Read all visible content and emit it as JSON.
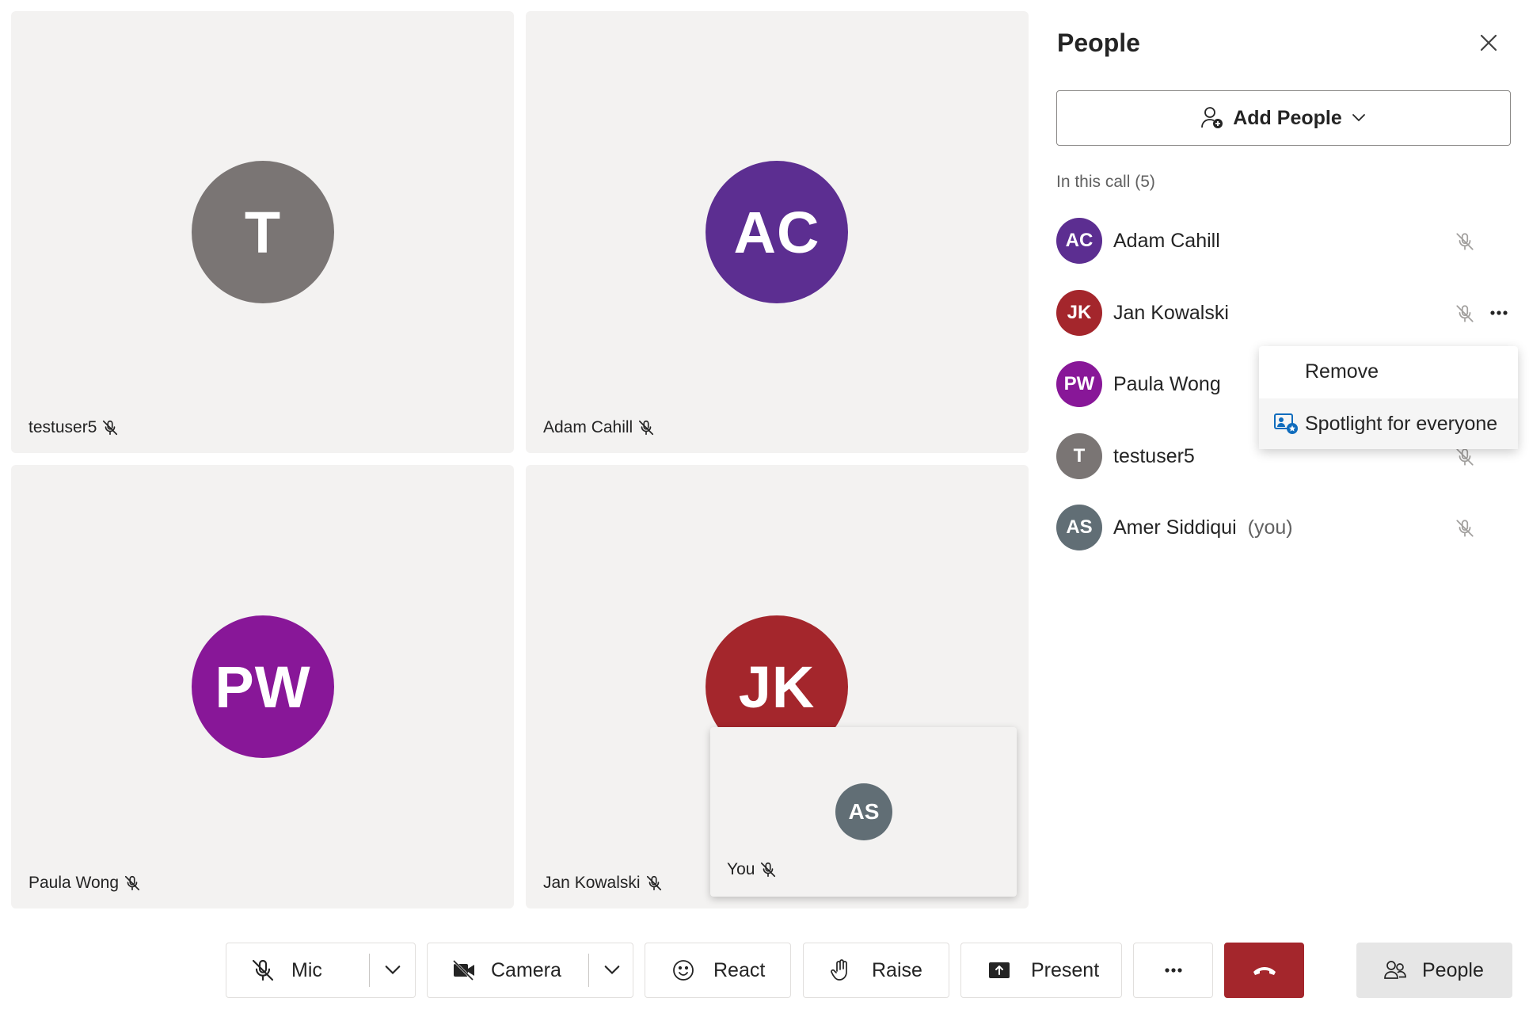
{
  "tiles": [
    {
      "initials": "T",
      "name": "testuser5",
      "color": "#7a7574"
    },
    {
      "initials": "AC",
      "name": "Adam Cahill",
      "color": "#5c2e91"
    },
    {
      "initials": "PW",
      "name": "Paula Wong",
      "color": "#881798"
    },
    {
      "initials": "JK",
      "name": "Jan Kowalski",
      "color": "#a4262c"
    }
  ],
  "self_view": {
    "initials": "AS",
    "label": "You"
  },
  "panel": {
    "title": "People",
    "add_people_label": "Add People",
    "in_call_label": "In this call (5)",
    "participants": [
      {
        "initials": "AC",
        "name": "Adam Cahill",
        "color": "#5c2e91",
        "you": ""
      },
      {
        "initials": "JK",
        "name": "Jan Kowalski",
        "color": "#a4262c",
        "you": ""
      },
      {
        "initials": "PW",
        "name": "Paula Wong",
        "color": "#881798",
        "you": ""
      },
      {
        "initials": "T",
        "name": "testuser5",
        "color": "#7a7574",
        "you": ""
      },
      {
        "initials": "AS",
        "name": "Amer Siddiqui",
        "color": "#616e75",
        "you": "(you)"
      }
    ]
  },
  "context_menu": {
    "remove": "Remove",
    "spotlight": "Spotlight for everyone"
  },
  "toolbar": {
    "mic": "Mic",
    "camera": "Camera",
    "react": "React",
    "raise": "Raise",
    "present": "Present",
    "people": "People",
    "hangup_color": "#a4262c"
  }
}
